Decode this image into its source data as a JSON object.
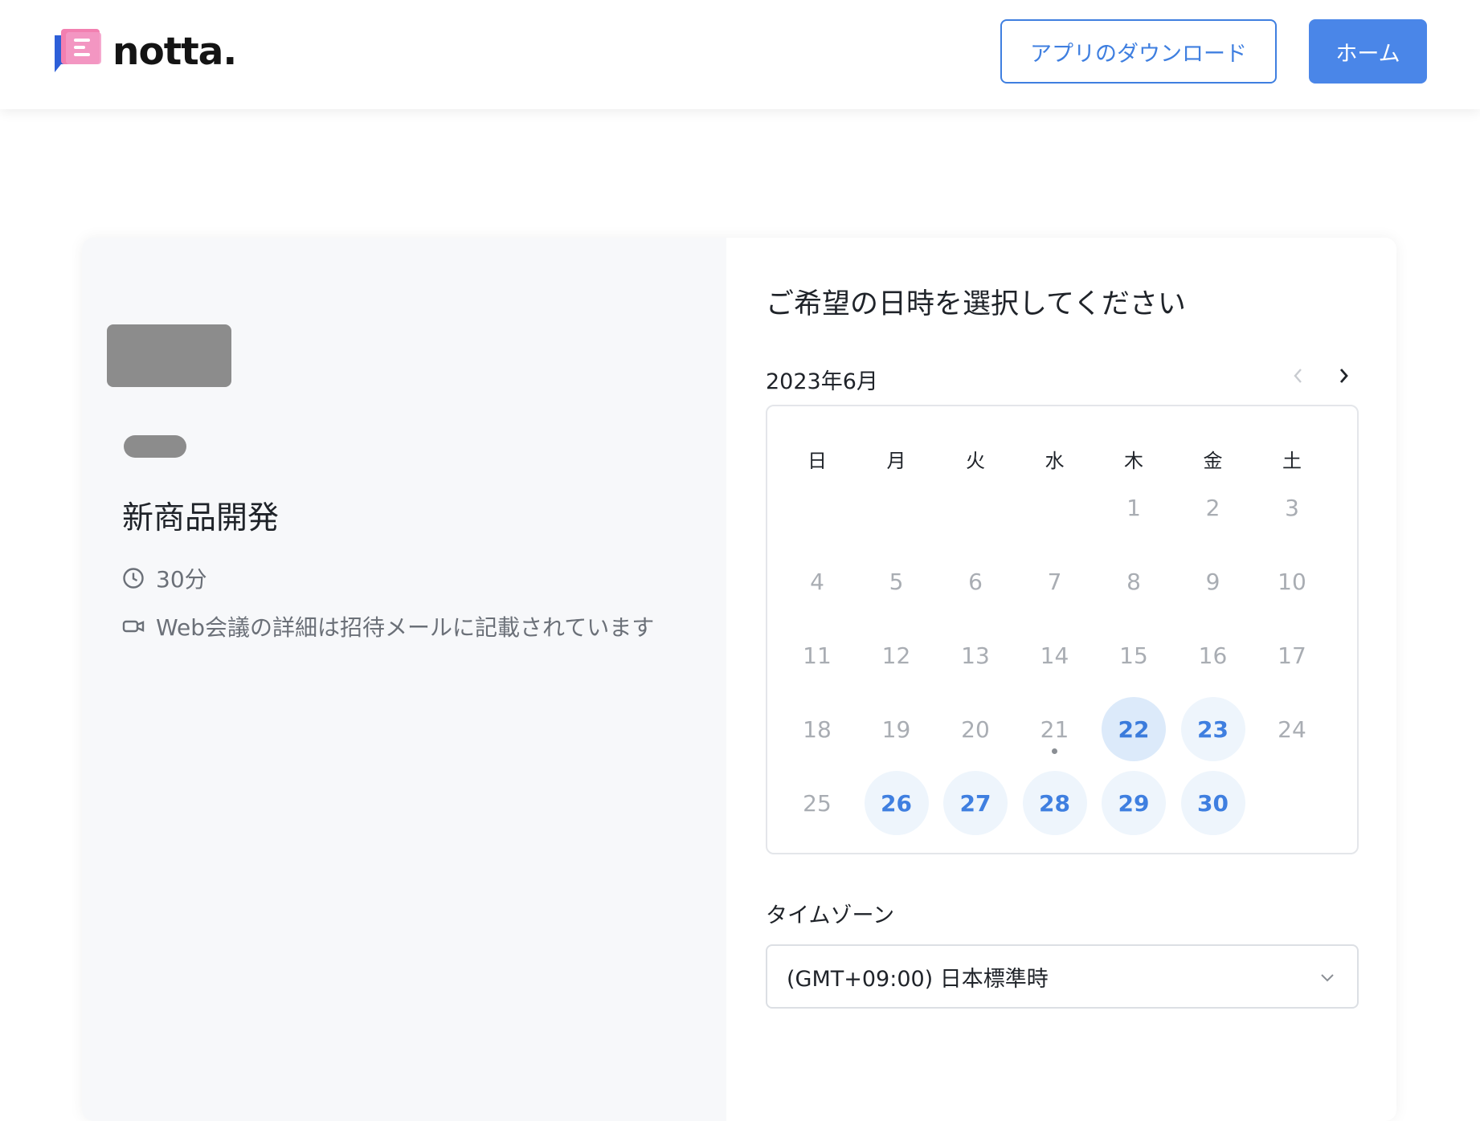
{
  "header": {
    "logo_text": "notta.",
    "download_label": "アプリのダウンロード",
    "home_label": "ホーム"
  },
  "event": {
    "title": "新商品開発",
    "duration": "30分",
    "meeting_note": "Web会議の詳細は招待メールに記載されています"
  },
  "scheduler": {
    "title": "ご希望の日時を選択してください",
    "month": "2023年6月",
    "weekdays": [
      "日",
      "月",
      "火",
      "水",
      "木",
      "金",
      "土"
    ],
    "first_weekday_index": 4,
    "days_in_month": 30,
    "today": 21,
    "selected_day": 22,
    "available_days": [
      22,
      23,
      26,
      27,
      28,
      29,
      30
    ]
  },
  "timezone": {
    "label": "タイムゾーン",
    "value": "(GMT+09:00) 日本標準時"
  },
  "colors": {
    "accent": "#4a86e8",
    "available_bg": "#eef5fc",
    "selected_bg": "#dceafa"
  },
  "icons": {
    "clock": "clock-icon",
    "video": "video-icon",
    "prev": "chevron-left-icon",
    "next": "chevron-right-icon",
    "dropdown": "chevron-down-icon"
  }
}
